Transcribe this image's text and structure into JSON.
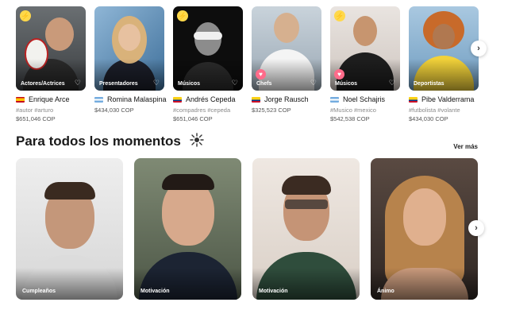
{
  "talents": [
    {
      "name": "Enrique Arce",
      "category": "Actores/Actrices",
      "flag": "es",
      "tags": "#autor #arturo",
      "price": "$651,046 COP",
      "badge": "bolt"
    },
    {
      "name": "Romina Malaspina",
      "category": "Presentadores",
      "flag": "ar",
      "tags": "",
      "price": "$434,030 COP",
      "badge": "bolt"
    },
    {
      "name": "Andrés Cepeda",
      "category": "Músicos",
      "flag": "co",
      "tags": "#compadres #cepeda",
      "price": "$651,046 COP",
      "badge": "bolt"
    },
    {
      "name": "Jorge Rausch",
      "category": "Chefs",
      "flag": "co",
      "tags": "",
      "price": "$325,523 COP",
      "badge": "heart"
    },
    {
      "name": "Noel Schajris",
      "category": "Músicos",
      "flag": "ar",
      "tags": "#Musico #mexico",
      "price": "$542,538 COP",
      "badge": "bolt"
    },
    {
      "name": "Pibe Valderrama",
      "category": "Deportistas",
      "flag": "co",
      "tags": "#futbolista #volante",
      "price": "$434,030 COP",
      "badge": "none"
    }
  ],
  "section": {
    "title": "Para todos los momentos",
    "see_more": "Ver más"
  },
  "moments": [
    {
      "label": "Cumpleaños"
    },
    {
      "label": "Motivación"
    },
    {
      "label": "Motivación"
    },
    {
      "label": "Ánimo"
    }
  ],
  "icons": {
    "next_arrow": "chevron-right-icon",
    "favorite": "heart-outline-icon",
    "bolt_badge": "lightning-icon",
    "heart_badge": "heart-icon"
  },
  "colors": {
    "bolt_badge": "#ffd84a",
    "heart_badge": "#ff6b8a",
    "title": "#1a1a1a"
  }
}
